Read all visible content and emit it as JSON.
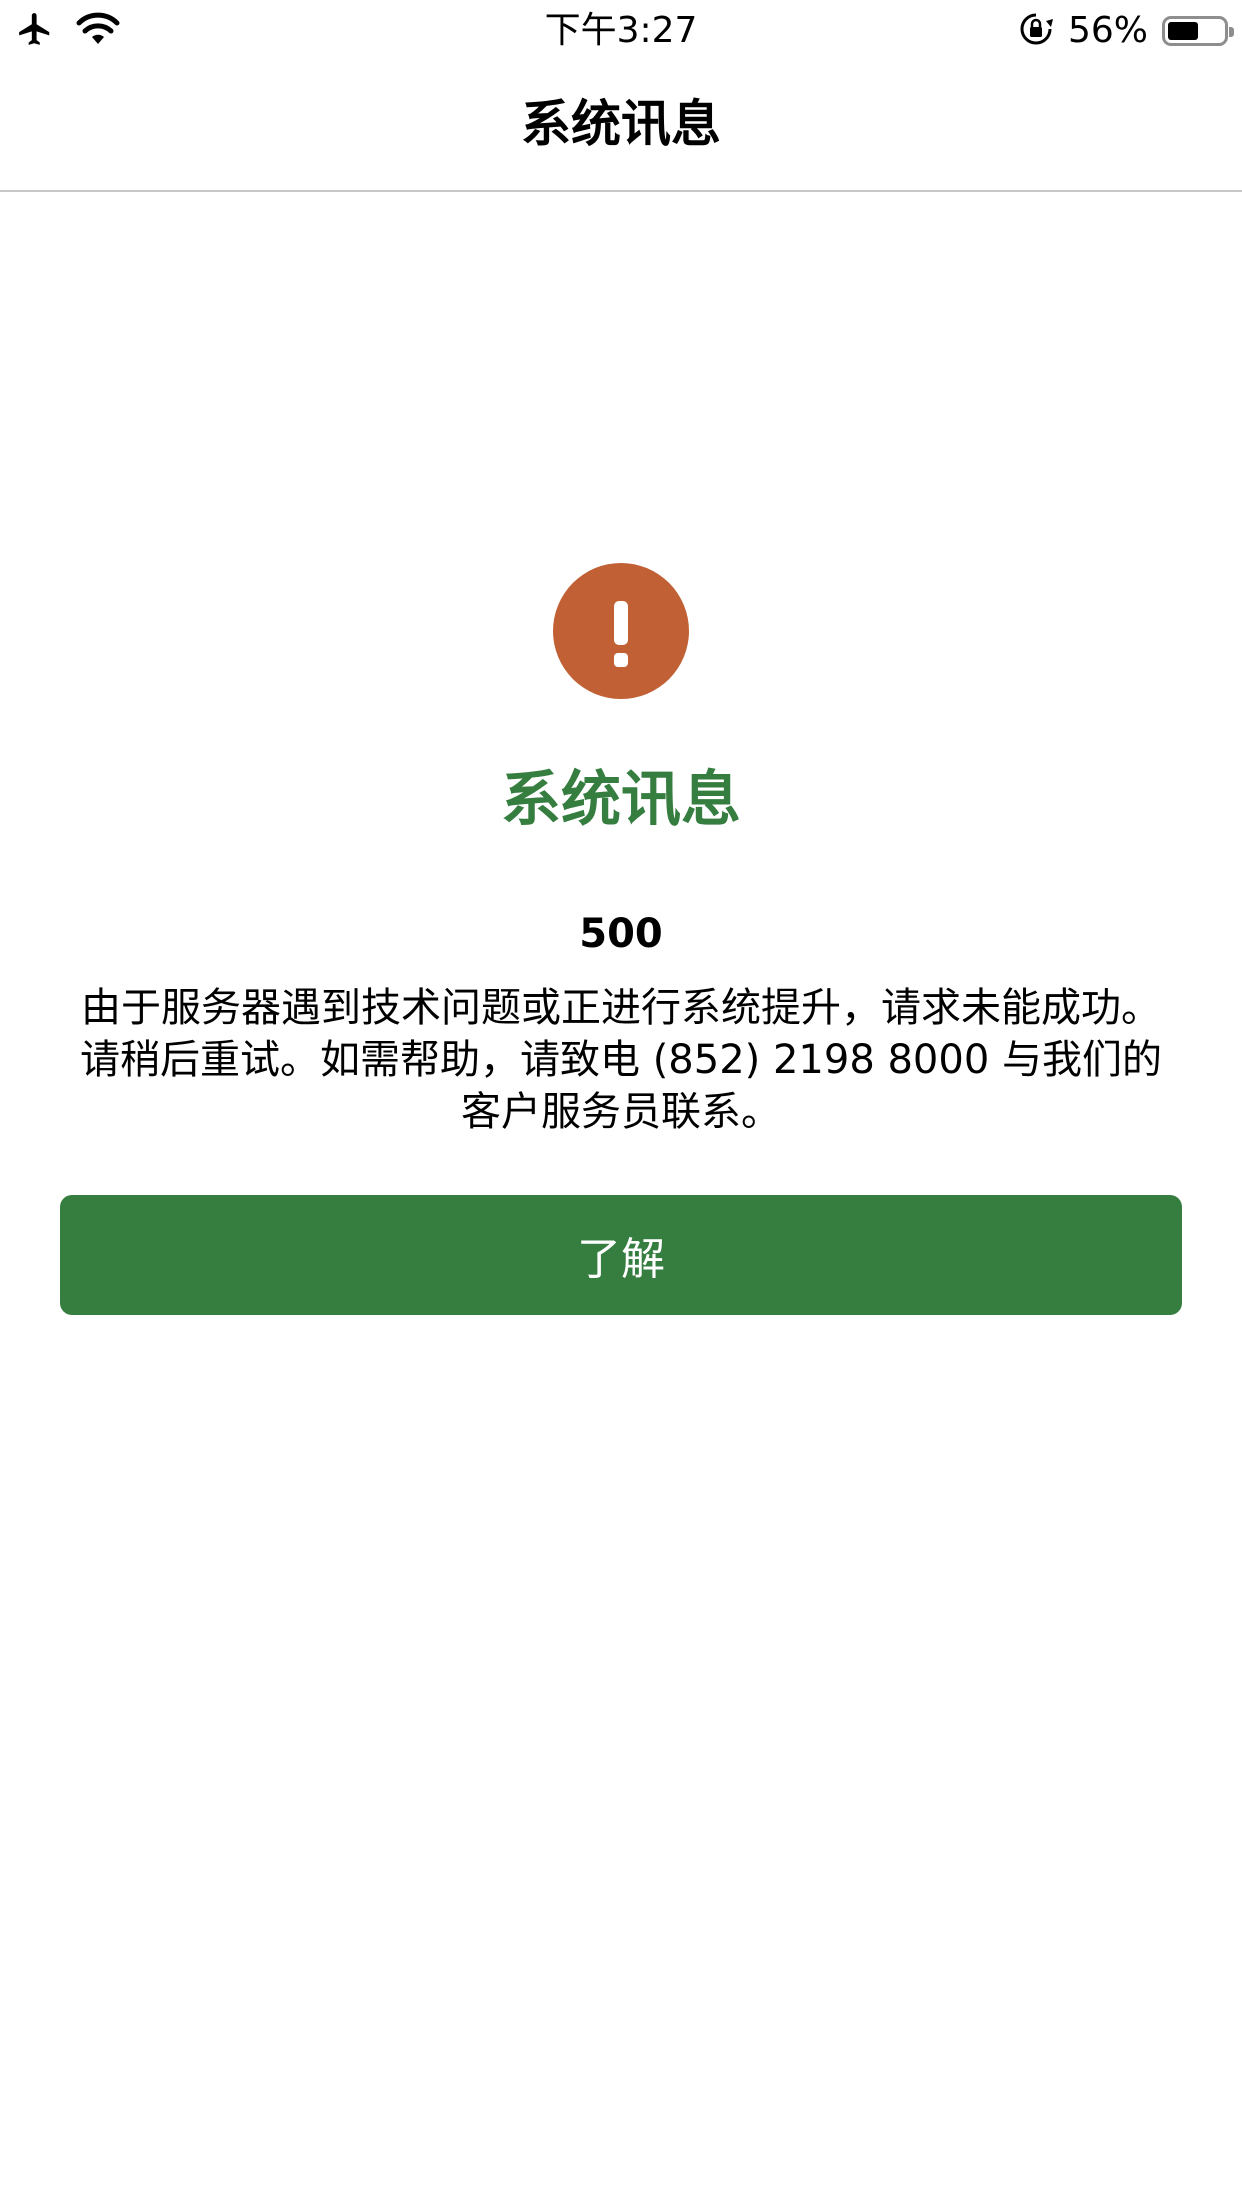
{
  "status_bar": {
    "time": "下午3:27",
    "battery_percent": "56%",
    "battery_level": 0.56,
    "icons": [
      "airplane-icon",
      "wifi-icon",
      "rotation-lock-icon",
      "battery-icon"
    ]
  },
  "nav": {
    "title": "系统讯息"
  },
  "alert": {
    "icon": "exclamation-icon",
    "icon_glyph": "!",
    "heading": "系统讯息",
    "code": "500",
    "message": "由于服务器遇到技术问题或正进行系统提升，请求未能成功。请稍后重试。如需帮助，请致电 (852) 2198 8000 与我们的客户服务员联系。",
    "button_label": "了解"
  },
  "colors": {
    "accent_green": "#367d40",
    "alert_orange": "#c06034",
    "divider": "#c8c8c8"
  }
}
